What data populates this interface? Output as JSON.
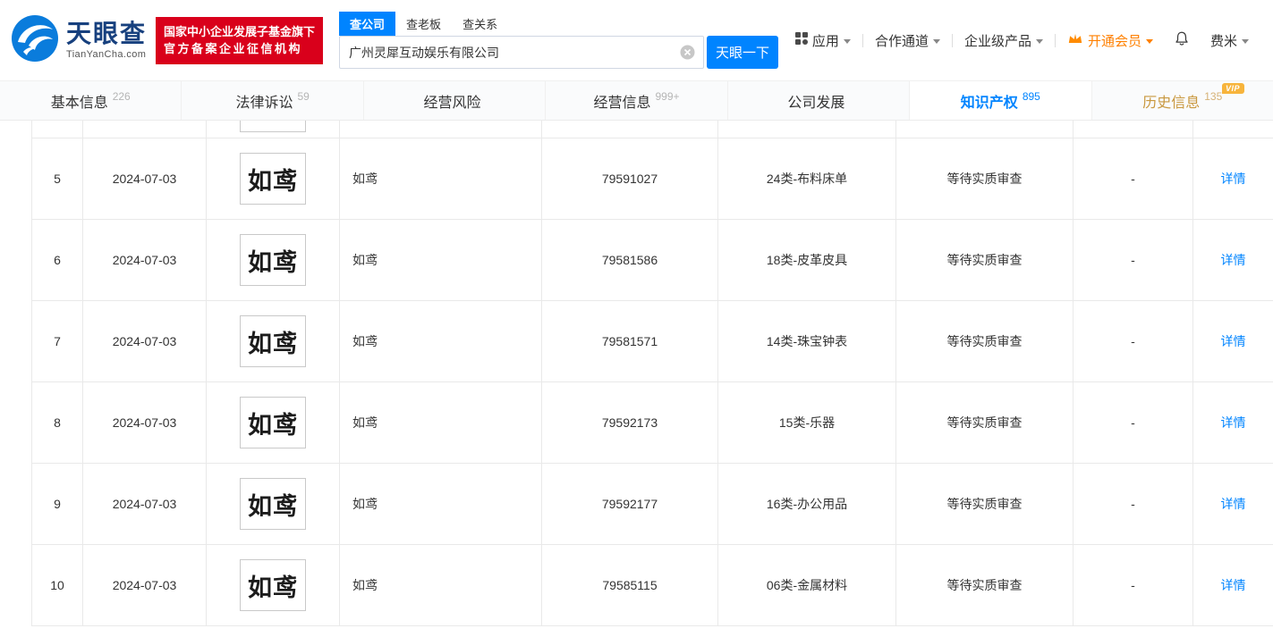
{
  "header": {
    "logo": {
      "brand": "天眼查",
      "domain": "TianYanCha.com"
    },
    "badge": {
      "line1": "国家中小企业发展子基金旗下",
      "line2": "官方备案企业征信机构"
    },
    "search": {
      "tabs": [
        {
          "label": "查公司",
          "active": true
        },
        {
          "label": "查老板",
          "active": false
        },
        {
          "label": "查关系",
          "active": false
        }
      ],
      "value": "广州灵犀互动娱乐有限公司",
      "button_label": "天眼一下"
    },
    "nav": {
      "apps": "应用",
      "cooperation": "合作通道",
      "enterprise": "企业级产品",
      "vip": "开通会员",
      "user": "费米"
    }
  },
  "tabs": [
    {
      "label": "基本信息",
      "count": "226",
      "active": false,
      "vip": false
    },
    {
      "label": "法律诉讼",
      "count": "59",
      "active": false,
      "vip": false
    },
    {
      "label": "经营风险",
      "count": "",
      "active": false,
      "vip": false
    },
    {
      "label": "经营信息",
      "count": "999+",
      "active": false,
      "vip": false
    },
    {
      "label": "公司发展",
      "count": "",
      "active": false,
      "vip": false
    },
    {
      "label": "知识产权",
      "count": "895",
      "active": true,
      "vip": false
    },
    {
      "label": "历史信息",
      "count": "135",
      "active": false,
      "vip": true
    }
  ],
  "vip_badge": "VIP",
  "table": {
    "rows": [
      {
        "no": "5",
        "date": "2024-07-03",
        "mark": "如鸢",
        "name": "如鸢",
        "reg_no": "79591027",
        "category": "24类-布料床单",
        "status": "等待实质审查",
        "col8": "-",
        "action": "详情"
      },
      {
        "no": "6",
        "date": "2024-07-03",
        "mark": "如鸢",
        "name": "如鸢",
        "reg_no": "79581586",
        "category": "18类-皮革皮具",
        "status": "等待实质审查",
        "col8": "-",
        "action": "详情"
      },
      {
        "no": "7",
        "date": "2024-07-03",
        "mark": "如鸢",
        "name": "如鸢",
        "reg_no": "79581571",
        "category": "14类-珠宝钟表",
        "status": "等待实质审查",
        "col8": "-",
        "action": "详情"
      },
      {
        "no": "8",
        "date": "2024-07-03",
        "mark": "如鸢",
        "name": "如鸢",
        "reg_no": "79592173",
        "category": "15类-乐器",
        "status": "等待实质审查",
        "col8": "-",
        "action": "详情"
      },
      {
        "no": "9",
        "date": "2024-07-03",
        "mark": "如鸢",
        "name": "如鸢",
        "reg_no": "79592177",
        "category": "16类-办公用品",
        "status": "等待实质审查",
        "col8": "-",
        "action": "详情"
      },
      {
        "no": "10",
        "date": "2024-07-03",
        "mark": "如鸢",
        "name": "如鸢",
        "reg_no": "79585115",
        "category": "06类-金属材料",
        "status": "等待实质审查",
        "col8": "-",
        "action": "详情"
      }
    ]
  },
  "colors": {
    "primary": "#0084ff",
    "badge_red": "#d9001b",
    "vip_orange": "#ff8000",
    "gold": "#c9983f"
  }
}
